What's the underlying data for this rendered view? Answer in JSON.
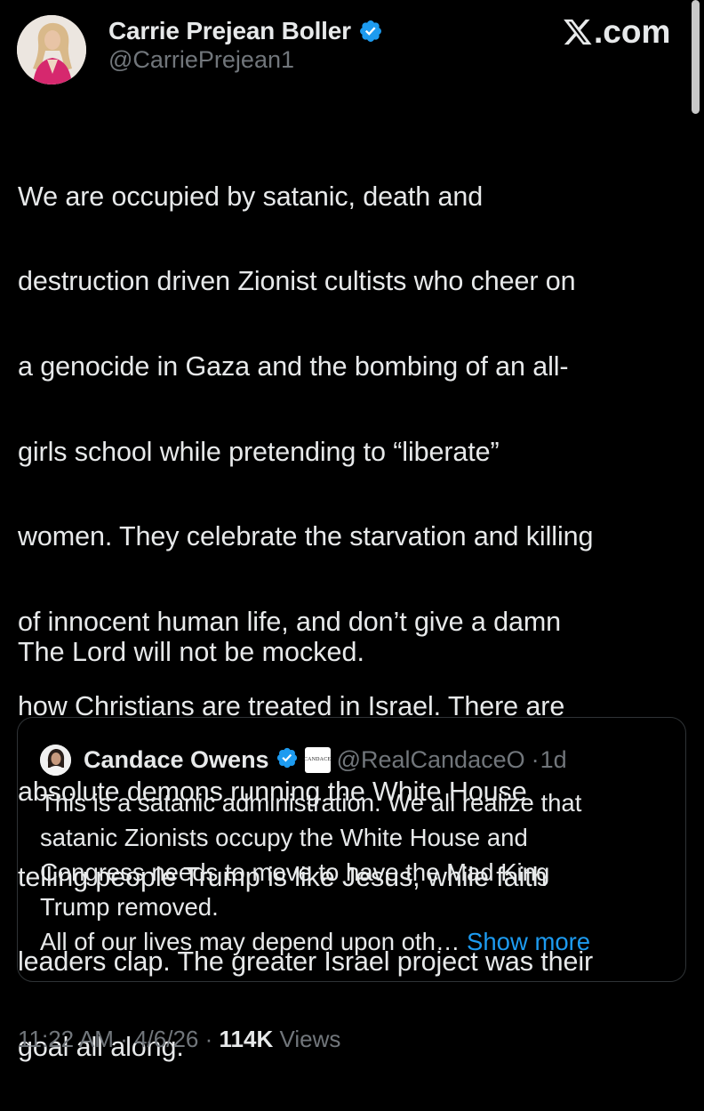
{
  "author": {
    "name": "Carrie Prejean Boller",
    "handle": "@CarriePrejean1",
    "verified": true
  },
  "site_label": ".com",
  "post": {
    "lines": [
      "We are occupied by satanic, death and",
      "destruction driven Zionist cultists who cheer on",
      "a genocide in Gaza and the bombing of an all-",
      "girls school while pretending to “liberate”",
      "women. They celebrate the starvation and killing",
      "of innocent human life, and don’t give a damn",
      "how Christians are treated in Israel. There are",
      "absolute demons running the White House",
      "telling people Trump is like Jesus, while faith",
      "leaders clap. The greater Israel project was their",
      "goal all along."
    ],
    "closing": "The Lord will not be mocked."
  },
  "quoted": {
    "name": "Candace Owens",
    "verified": true,
    "affiliate_badge_text": "CANDACE",
    "handle": "@RealCandaceO",
    "separator": "·",
    "time": "1d",
    "lines": [
      "This is a satanic administration. We all realize that",
      "satanic Zionists occupy the White House and",
      "Congress needs to move to have the Mad King",
      "Trump removed.",
      "All of our lives may depend upon oth…"
    ],
    "show_more": "Show more"
  },
  "meta": {
    "time": "11:22 AM",
    "date": "4/6/26",
    "separator": "·",
    "views_count": "114K",
    "views_label": "Views"
  },
  "colors": {
    "background": "#000000",
    "text": "#e7e9ea",
    "muted": "#71767b",
    "link": "#1d9bf0",
    "verified": "#1d9bf0",
    "border": "#2f3336"
  }
}
